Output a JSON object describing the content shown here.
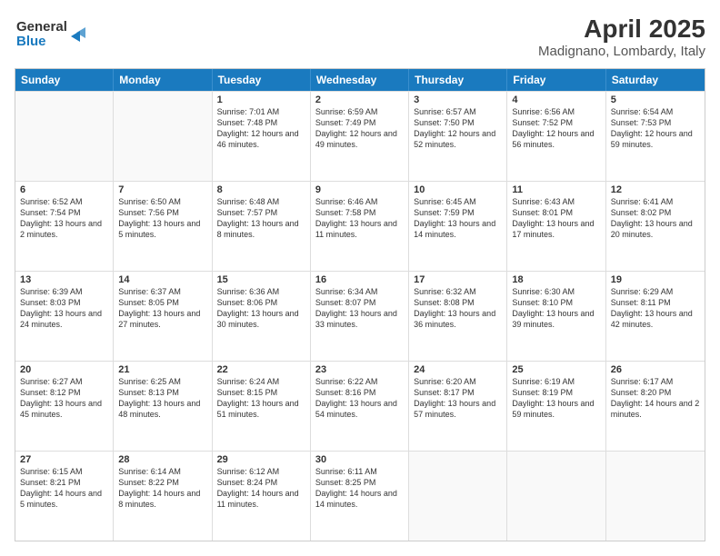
{
  "header": {
    "logo_line1": "General",
    "logo_line2": "Blue",
    "month": "April 2025",
    "location": "Madignano, Lombardy, Italy"
  },
  "days": [
    "Sunday",
    "Monday",
    "Tuesday",
    "Wednesday",
    "Thursday",
    "Friday",
    "Saturday"
  ],
  "rows": [
    [
      {
        "day": "",
        "empty": true
      },
      {
        "day": "",
        "empty": true
      },
      {
        "day": "1",
        "sunrise": "Sunrise: 7:01 AM",
        "sunset": "Sunset: 7:48 PM",
        "daylight": "Daylight: 12 hours and 46 minutes."
      },
      {
        "day": "2",
        "sunrise": "Sunrise: 6:59 AM",
        "sunset": "Sunset: 7:49 PM",
        "daylight": "Daylight: 12 hours and 49 minutes."
      },
      {
        "day": "3",
        "sunrise": "Sunrise: 6:57 AM",
        "sunset": "Sunset: 7:50 PM",
        "daylight": "Daylight: 12 hours and 52 minutes."
      },
      {
        "day": "4",
        "sunrise": "Sunrise: 6:56 AM",
        "sunset": "Sunset: 7:52 PM",
        "daylight": "Daylight: 12 hours and 56 minutes."
      },
      {
        "day": "5",
        "sunrise": "Sunrise: 6:54 AM",
        "sunset": "Sunset: 7:53 PM",
        "daylight": "Daylight: 12 hours and 59 minutes."
      }
    ],
    [
      {
        "day": "6",
        "sunrise": "Sunrise: 6:52 AM",
        "sunset": "Sunset: 7:54 PM",
        "daylight": "Daylight: 13 hours and 2 minutes."
      },
      {
        "day": "7",
        "sunrise": "Sunrise: 6:50 AM",
        "sunset": "Sunset: 7:56 PM",
        "daylight": "Daylight: 13 hours and 5 minutes."
      },
      {
        "day": "8",
        "sunrise": "Sunrise: 6:48 AM",
        "sunset": "Sunset: 7:57 PM",
        "daylight": "Daylight: 13 hours and 8 minutes."
      },
      {
        "day": "9",
        "sunrise": "Sunrise: 6:46 AM",
        "sunset": "Sunset: 7:58 PM",
        "daylight": "Daylight: 13 hours and 11 minutes."
      },
      {
        "day": "10",
        "sunrise": "Sunrise: 6:45 AM",
        "sunset": "Sunset: 7:59 PM",
        "daylight": "Daylight: 13 hours and 14 minutes."
      },
      {
        "day": "11",
        "sunrise": "Sunrise: 6:43 AM",
        "sunset": "Sunset: 8:01 PM",
        "daylight": "Daylight: 13 hours and 17 minutes."
      },
      {
        "day": "12",
        "sunrise": "Sunrise: 6:41 AM",
        "sunset": "Sunset: 8:02 PM",
        "daylight": "Daylight: 13 hours and 20 minutes."
      }
    ],
    [
      {
        "day": "13",
        "sunrise": "Sunrise: 6:39 AM",
        "sunset": "Sunset: 8:03 PM",
        "daylight": "Daylight: 13 hours and 24 minutes."
      },
      {
        "day": "14",
        "sunrise": "Sunrise: 6:37 AM",
        "sunset": "Sunset: 8:05 PM",
        "daylight": "Daylight: 13 hours and 27 minutes."
      },
      {
        "day": "15",
        "sunrise": "Sunrise: 6:36 AM",
        "sunset": "Sunset: 8:06 PM",
        "daylight": "Daylight: 13 hours and 30 minutes."
      },
      {
        "day": "16",
        "sunrise": "Sunrise: 6:34 AM",
        "sunset": "Sunset: 8:07 PM",
        "daylight": "Daylight: 13 hours and 33 minutes."
      },
      {
        "day": "17",
        "sunrise": "Sunrise: 6:32 AM",
        "sunset": "Sunset: 8:08 PM",
        "daylight": "Daylight: 13 hours and 36 minutes."
      },
      {
        "day": "18",
        "sunrise": "Sunrise: 6:30 AM",
        "sunset": "Sunset: 8:10 PM",
        "daylight": "Daylight: 13 hours and 39 minutes."
      },
      {
        "day": "19",
        "sunrise": "Sunrise: 6:29 AM",
        "sunset": "Sunset: 8:11 PM",
        "daylight": "Daylight: 13 hours and 42 minutes."
      }
    ],
    [
      {
        "day": "20",
        "sunrise": "Sunrise: 6:27 AM",
        "sunset": "Sunset: 8:12 PM",
        "daylight": "Daylight: 13 hours and 45 minutes."
      },
      {
        "day": "21",
        "sunrise": "Sunrise: 6:25 AM",
        "sunset": "Sunset: 8:13 PM",
        "daylight": "Daylight: 13 hours and 48 minutes."
      },
      {
        "day": "22",
        "sunrise": "Sunrise: 6:24 AM",
        "sunset": "Sunset: 8:15 PM",
        "daylight": "Daylight: 13 hours and 51 minutes."
      },
      {
        "day": "23",
        "sunrise": "Sunrise: 6:22 AM",
        "sunset": "Sunset: 8:16 PM",
        "daylight": "Daylight: 13 hours and 54 minutes."
      },
      {
        "day": "24",
        "sunrise": "Sunrise: 6:20 AM",
        "sunset": "Sunset: 8:17 PM",
        "daylight": "Daylight: 13 hours and 57 minutes."
      },
      {
        "day": "25",
        "sunrise": "Sunrise: 6:19 AM",
        "sunset": "Sunset: 8:19 PM",
        "daylight": "Daylight: 13 hours and 59 minutes."
      },
      {
        "day": "26",
        "sunrise": "Sunrise: 6:17 AM",
        "sunset": "Sunset: 8:20 PM",
        "daylight": "Daylight: 14 hours and 2 minutes."
      }
    ],
    [
      {
        "day": "27",
        "sunrise": "Sunrise: 6:15 AM",
        "sunset": "Sunset: 8:21 PM",
        "daylight": "Daylight: 14 hours and 5 minutes."
      },
      {
        "day": "28",
        "sunrise": "Sunrise: 6:14 AM",
        "sunset": "Sunset: 8:22 PM",
        "daylight": "Daylight: 14 hours and 8 minutes."
      },
      {
        "day": "29",
        "sunrise": "Sunrise: 6:12 AM",
        "sunset": "Sunset: 8:24 PM",
        "daylight": "Daylight: 14 hours and 11 minutes."
      },
      {
        "day": "30",
        "sunrise": "Sunrise: 6:11 AM",
        "sunset": "Sunset: 8:25 PM",
        "daylight": "Daylight: 14 hours and 14 minutes."
      },
      {
        "day": "",
        "empty": true
      },
      {
        "day": "",
        "empty": true
      },
      {
        "day": "",
        "empty": true
      }
    ]
  ]
}
